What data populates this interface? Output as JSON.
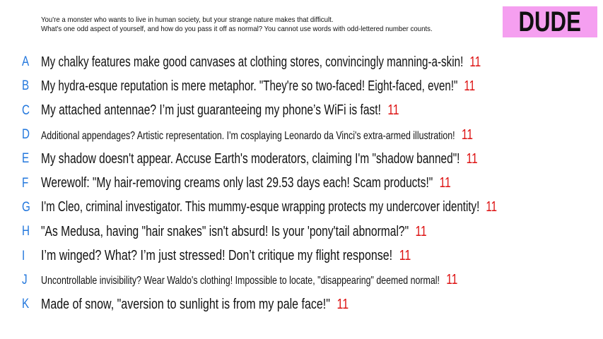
{
  "prompt": {
    "line1": "You're a monster who wants to live in human society, but your strange nature makes that difficult.",
    "line2": "What's one odd aspect of yourself, and how do you pass it off as normal? You cannot use words with odd-lettered number counts."
  },
  "player": {
    "name": "DUDE",
    "badge_color": "#f59ff0"
  },
  "colors": {
    "letter": "#2277dd",
    "count": "#dd1111"
  },
  "answers": [
    {
      "letter": "A",
      "text": "My chalky features make good canvases at clothing stores, convincingly manning-a-skin!",
      "count": "11"
    },
    {
      "letter": "B",
      "text": "My hydra-esque reputation is mere metaphor. \"They're so two-faced! Eight-faced, even!\"",
      "count": "11"
    },
    {
      "letter": "C",
      "text": "My attached antennae? I’m just guaranteeing my phone’s WiFi is fast!",
      "count": "11"
    },
    {
      "letter": "D",
      "text": "Additional appendages? Artistic representation. I'm cosplaying Leonardo da Vinci's extra-armed illustration!",
      "count": "11"
    },
    {
      "letter": "E",
      "text": "My shadow doesn't appear. Accuse Earth's moderators, claiming I'm \"shadow banned\"!",
      "count": "11"
    },
    {
      "letter": "F",
      "text": "Werewolf: \"My hair-removing creams only last 29.53 days each! Scam products!\"",
      "count": "11"
    },
    {
      "letter": "G",
      "text": "I'm Cleo, criminal investigator. This mummy-esque wrapping protects my undercover identity!",
      "count": "11"
    },
    {
      "letter": "H",
      "text": "\"As Medusa, having \"hair snakes\" isn't absurd! Is your 'pony'tail abnormal?\"",
      "count": "11"
    },
    {
      "letter": "I",
      "text": "I’m winged? What? I’m just stressed! Don’t critique my flight response!",
      "count": "11"
    },
    {
      "letter": "J",
      "text": "Uncontrollable invisibility? Wear Waldo's clothing! Impossible to locate, \"disappearing\" deemed normal!",
      "count": "11"
    },
    {
      "letter": "K",
      "text": "Made of snow, \"aversion to sunlight is from my pale face!\"",
      "count": "11"
    }
  ]
}
